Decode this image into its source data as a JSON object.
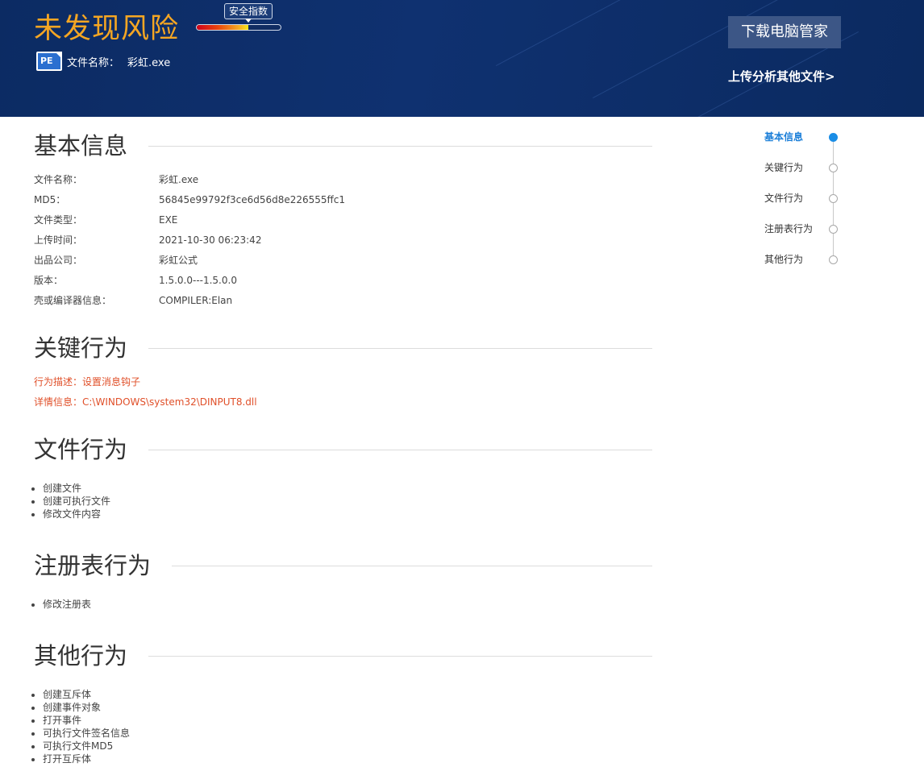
{
  "header": {
    "status_title": "未发现风险",
    "gauge_label": "安全指数",
    "gauge_level": 0.62,
    "file_label": "文件名称：",
    "file_name": "彩虹.exe",
    "file_type_icon": "PE",
    "download_button": "下载电脑管家",
    "upload_link": "上传分析其他文件>"
  },
  "colors": {
    "header_bg": "#0f3170",
    "title_orange": "#f5a623",
    "alert_red": "#e0502a",
    "nav_active": "#1a7ed8"
  },
  "sections": {
    "basic": {
      "title": "基本信息",
      "rows": [
        {
          "key": "文件名称：",
          "value": "彩虹.exe"
        },
        {
          "key": "MD5：",
          "value": "56845e99792f3ce6d56d8e226555ffc1"
        },
        {
          "key": "文件类型：",
          "value": "EXE"
        },
        {
          "key": "上传时间：",
          "value": "2021-10-30 06:23:42"
        },
        {
          "key": "出品公司：",
          "value": "彩虹公式"
        },
        {
          "key": "版本：",
          "value": "1.5.0.0---1.5.0.0"
        },
        {
          "key": "壳或编译器信息：",
          "value": "COMPILER:Elan"
        }
      ]
    },
    "key_behavior": {
      "title": "关键行为",
      "description": "行为描述：设置消息钩子",
      "detail": "详情信息：C:\\WINDOWS\\system32\\DINPUT8.dll"
    },
    "file_behavior": {
      "title": "文件行为",
      "items": [
        "创建文件",
        "创建可执行文件",
        "修改文件内容"
      ]
    },
    "registry_behavior": {
      "title": "注册表行为",
      "items": [
        "修改注册表"
      ]
    },
    "other_behavior": {
      "title": "其他行为",
      "items": [
        "创建互斥体",
        "创建事件对象",
        "打开事件",
        "可执行文件签名信息",
        "可执行文件MD5",
        "打开互斥体"
      ]
    }
  },
  "nav": {
    "items": [
      "基本信息",
      "关键行为",
      "文件行为",
      "注册表行为",
      "其他行为"
    ],
    "active": "基本信息"
  }
}
